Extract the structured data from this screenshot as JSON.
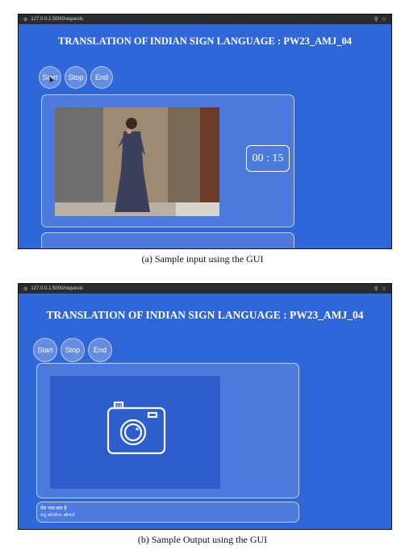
{
  "screens": {
    "a": {
      "url": "127.0.0.1:5000/requests",
      "title": "TRANSLATION OF INDIAN SIGN LANGUAGE : PW23_AMJ_04",
      "buttons": {
        "start": "Start",
        "stop": "Stop",
        "end": "End"
      },
      "timer": "00 : 15"
    },
    "b": {
      "url": "127.0.0.1:5000/requests",
      "title": "TRANSLATION OF INDIAN SIGN LANGUAGE : PW23_AMJ_04",
      "buttons": {
        "start": "Start",
        "stop": "Stop",
        "end": "End"
      },
      "output_line1": "मेरा नाम क्या है",
      "output_line2": "ನನ್ನ ಹೆಸರೇನು ಹೇಳಿದೆ"
    }
  },
  "captions": {
    "a": "(a) Sample input using the GUI",
    "b": "(b) Sample Output using the GUI"
  },
  "icons": {
    "search": "search-icon",
    "star": "star-icon",
    "camera": "camera-icon"
  },
  "colors": {
    "background": "#2f66d8",
    "chrome": "#2a2b2f"
  }
}
